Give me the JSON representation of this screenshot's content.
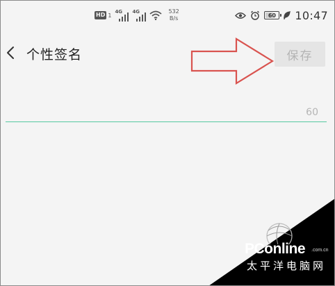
{
  "status_bar": {
    "hd_label": "HD",
    "hd_sub": "1",
    "network_1": "4G",
    "network_2": "4G",
    "speed_value": "532",
    "speed_unit": "B/s",
    "battery_percent": "60",
    "battery_fraction": 0.6,
    "time": "10:47",
    "icons": [
      "hd-badge",
      "signal-bars-icon",
      "wifi-icon",
      "eye-icon",
      "alarm-icon",
      "battery-icon",
      "leaf-icon"
    ]
  },
  "toolbar": {
    "back_icon": "chevron-left-icon",
    "title": "个性签名",
    "save_label": "保存"
  },
  "signature_input": {
    "value": "",
    "placeholder": "",
    "max_length_label": "60",
    "underline_color": "#55c8a0"
  },
  "annotation": {
    "type": "red-outline-arrow",
    "color": "#d9534f"
  },
  "watermark": {
    "brand": "PConline",
    "domain": ".com.cn",
    "chinese": "太平洋电脑网"
  }
}
